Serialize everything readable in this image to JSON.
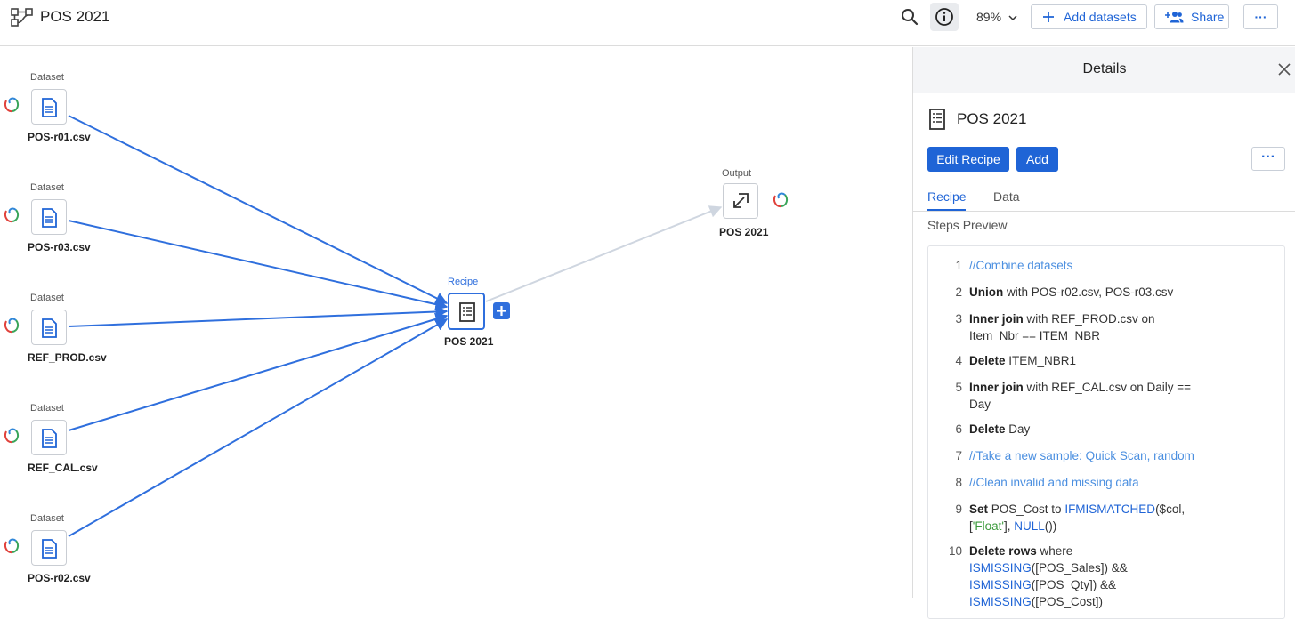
{
  "header": {
    "title": "POS 2021",
    "zoom": "89%",
    "add_datasets_label": "Add datasets",
    "share_label": "Share",
    "more_label": "···"
  },
  "canvas": {
    "datasets": [
      {
        "caption": "Dataset",
        "name": "POS-r01.csv"
      },
      {
        "caption": "Dataset",
        "name": "POS-r03.csv"
      },
      {
        "caption": "Dataset",
        "name": "REF_PROD.csv"
      },
      {
        "caption": "Dataset",
        "name": "REF_CAL.csv"
      },
      {
        "caption": "Dataset",
        "name": "POS-r02.csv"
      }
    ],
    "recipe": {
      "caption": "Recipe",
      "name": "POS 2021"
    },
    "output": {
      "caption": "Output",
      "name": "POS 2021"
    }
  },
  "details": {
    "title": "Details",
    "recipe_name": "POS 2021",
    "edit_recipe_label": "Edit Recipe",
    "add_label": "Add",
    "more_label": "···",
    "tabs": [
      "Recipe",
      "Data"
    ],
    "steps_title": "Steps Preview",
    "steps": [
      {
        "num": "1",
        "parts": [
          {
            "t": "//Combine datasets",
            "c": "cm"
          }
        ]
      },
      {
        "num": "2",
        "parts": [
          {
            "t": "Union",
            "c": "kw"
          },
          {
            "t": " with POS-r02.csv, POS-r03.csv",
            "c": ""
          }
        ]
      },
      {
        "num": "3",
        "parts": [
          {
            "t": "Inner join",
            "c": "kw"
          },
          {
            "t": " with REF_PROD.csv on Item_Nbr == ITEM_NBR",
            "c": ""
          }
        ]
      },
      {
        "num": "4",
        "parts": [
          {
            "t": "Delete",
            "c": "kw"
          },
          {
            "t": " ITEM_NBR1",
            "c": ""
          }
        ]
      },
      {
        "num": "5",
        "parts": [
          {
            "t": "Inner join",
            "c": "kw"
          },
          {
            "t": " with REF_CAL.csv on Daily == Day",
            "c": ""
          }
        ]
      },
      {
        "num": "6",
        "parts": [
          {
            "t": "Delete",
            "c": "kw"
          },
          {
            "t": " Day",
            "c": ""
          }
        ]
      },
      {
        "num": "7",
        "parts": [
          {
            "t": "//Take a new sample: Quick Scan, random",
            "c": "cm"
          }
        ]
      },
      {
        "num": "8",
        "parts": [
          {
            "t": "//Clean invalid and missing data",
            "c": "cm"
          }
        ]
      },
      {
        "num": "9",
        "parts": [
          {
            "t": "Set",
            "c": "kw"
          },
          {
            "t": " POS_Cost to ",
            "c": ""
          },
          {
            "t": "IFMISMATCHED",
            "c": "fn"
          },
          {
            "t": "($col, [",
            "c": ""
          },
          {
            "t": "'Float'",
            "c": "str"
          },
          {
            "t": "], ",
            "c": ""
          },
          {
            "t": "NULL",
            "c": "fn"
          },
          {
            "t": "())",
            "c": ""
          }
        ]
      },
      {
        "num": "10",
        "parts": [
          {
            "t": "Delete rows",
            "c": "kw"
          },
          {
            "t": " where ",
            "c": ""
          },
          {
            "t": "ISMISSING",
            "c": "fn"
          },
          {
            "t": "([POS_Sales]) && ",
            "c": ""
          },
          {
            "t": "ISMISSING",
            "c": "fn"
          },
          {
            "t": "([POS_Qty]) && ",
            "c": ""
          },
          {
            "t": "ISMISSING",
            "c": "fn"
          },
          {
            "t": "([POS_Cost])",
            "c": ""
          }
        ]
      }
    ]
  },
  "colors": {
    "accent": "#1f64d6",
    "edge_active": "#2f6fdd",
    "edge_inactive": "#cfd6e0"
  }
}
